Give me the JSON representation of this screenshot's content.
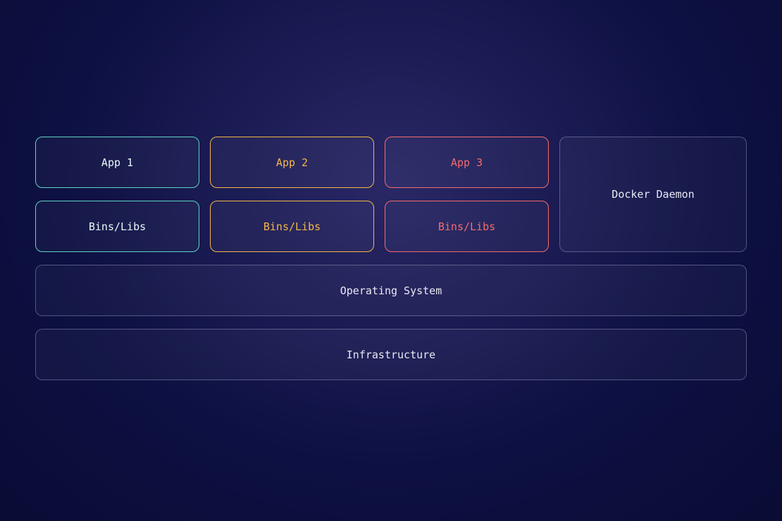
{
  "diagram": {
    "containers": [
      {
        "app": "App 1",
        "libs": "Bins/Libs",
        "color": "teal"
      },
      {
        "app": "App 2",
        "libs": "Bins/Libs",
        "color": "amber"
      },
      {
        "app": "App 3",
        "libs": "Bins/Libs",
        "color": "coral"
      }
    ],
    "daemon": "Docker Daemon",
    "os_layer": "Operating System",
    "infra_layer": "Infrastructure",
    "colors": {
      "teal": "#5ed4c4",
      "amber": "#f5b74a",
      "coral": "#f56b6b",
      "neutral": "rgba(200,200,230,0.35)",
      "background_center": "#2a2866",
      "background_outer": "#0a0c35"
    }
  }
}
